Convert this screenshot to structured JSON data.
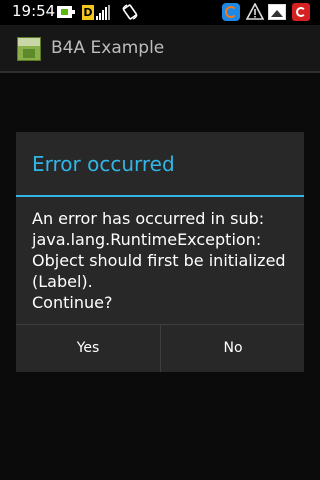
{
  "status_bar": {
    "time": "19:54",
    "icons": [
      "battery-icon",
      "data-icon",
      "signal-icon",
      "rotate-icon",
      "sync-icon",
      "warning-icon",
      "image-icon",
      "security-icon"
    ],
    "d_label": "D"
  },
  "app": {
    "title": "B4A Example",
    "icon": "app-icon"
  },
  "dialog": {
    "title": "Error occurred",
    "message_lines": [
      "An error has occurred in sub:",
      "java.lang.RuntimeException:",
      "Object should first be initialized",
      "(Label).",
      "Continue?"
    ],
    "buttons": {
      "yes": "Yes",
      "no": "No"
    }
  },
  "colors": {
    "accent": "#33b5e5",
    "dialog_bg": "#282828",
    "background": "#000000"
  }
}
